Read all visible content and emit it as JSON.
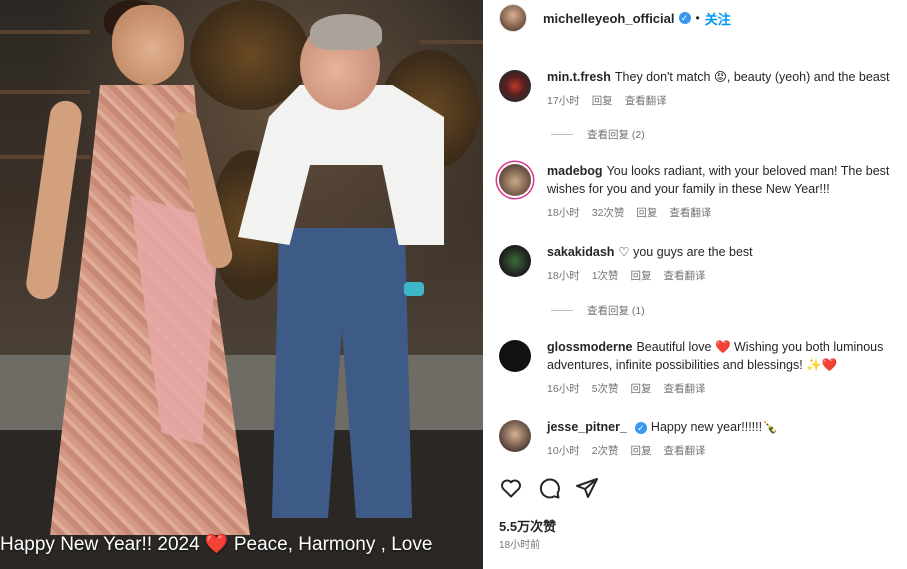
{
  "photo": {
    "caption": "Happy New Year!! 2024 ❤️ Peace, Harmony , Love"
  },
  "post": {
    "owner": "michelleyeoh_official",
    "follow_label": "关注",
    "likes": "5.5万次赞",
    "time": "18小时前"
  },
  "comments": [
    {
      "user": "min.t.fresh",
      "text": "They don't match 😡, beauty (yeoh) and the beast",
      "time": "17小时",
      "likes": "",
      "reply": "回复",
      "translate": "查看翻译",
      "view_replies": "查看回复 (2)"
    },
    {
      "user": "madebog",
      "text": "You looks radiant, with your beloved man! The best wishes for you and your family in these New Year!!!",
      "time": "18小时",
      "likes": "32次赞",
      "reply": "回复",
      "translate": "查看翻译"
    },
    {
      "user": "sakakidash",
      "text": "♡ you guys are the best",
      "time": "18小时",
      "likes": "1次赞",
      "reply": "回复",
      "translate": "查看翻译",
      "view_replies": "查看回复 (1)"
    },
    {
      "user": "glossmoderne",
      "text": "Beautiful love ❤️ Wishing you both luminous adventures, infinite possibilities and blessings! ✨❤️",
      "time": "16小时",
      "likes": "5次赞",
      "reply": "回复",
      "translate": "查看翻译"
    },
    {
      "user": "jesse_pitner_",
      "text": "Happy new year!!!!!!🍾",
      "time": "10小时",
      "likes": "2次赞",
      "reply": "回复",
      "translate": "查看翻译"
    }
  ],
  "icons": {
    "like": "heart-outline-icon",
    "comment": "speech-bubble-icon",
    "share": "paper-plane-icon",
    "verified": "verified-badge-icon"
  },
  "colors": {
    "accent": "#0095f6",
    "verified": "#3897f0",
    "muted": "#737373",
    "text": "#262626"
  }
}
